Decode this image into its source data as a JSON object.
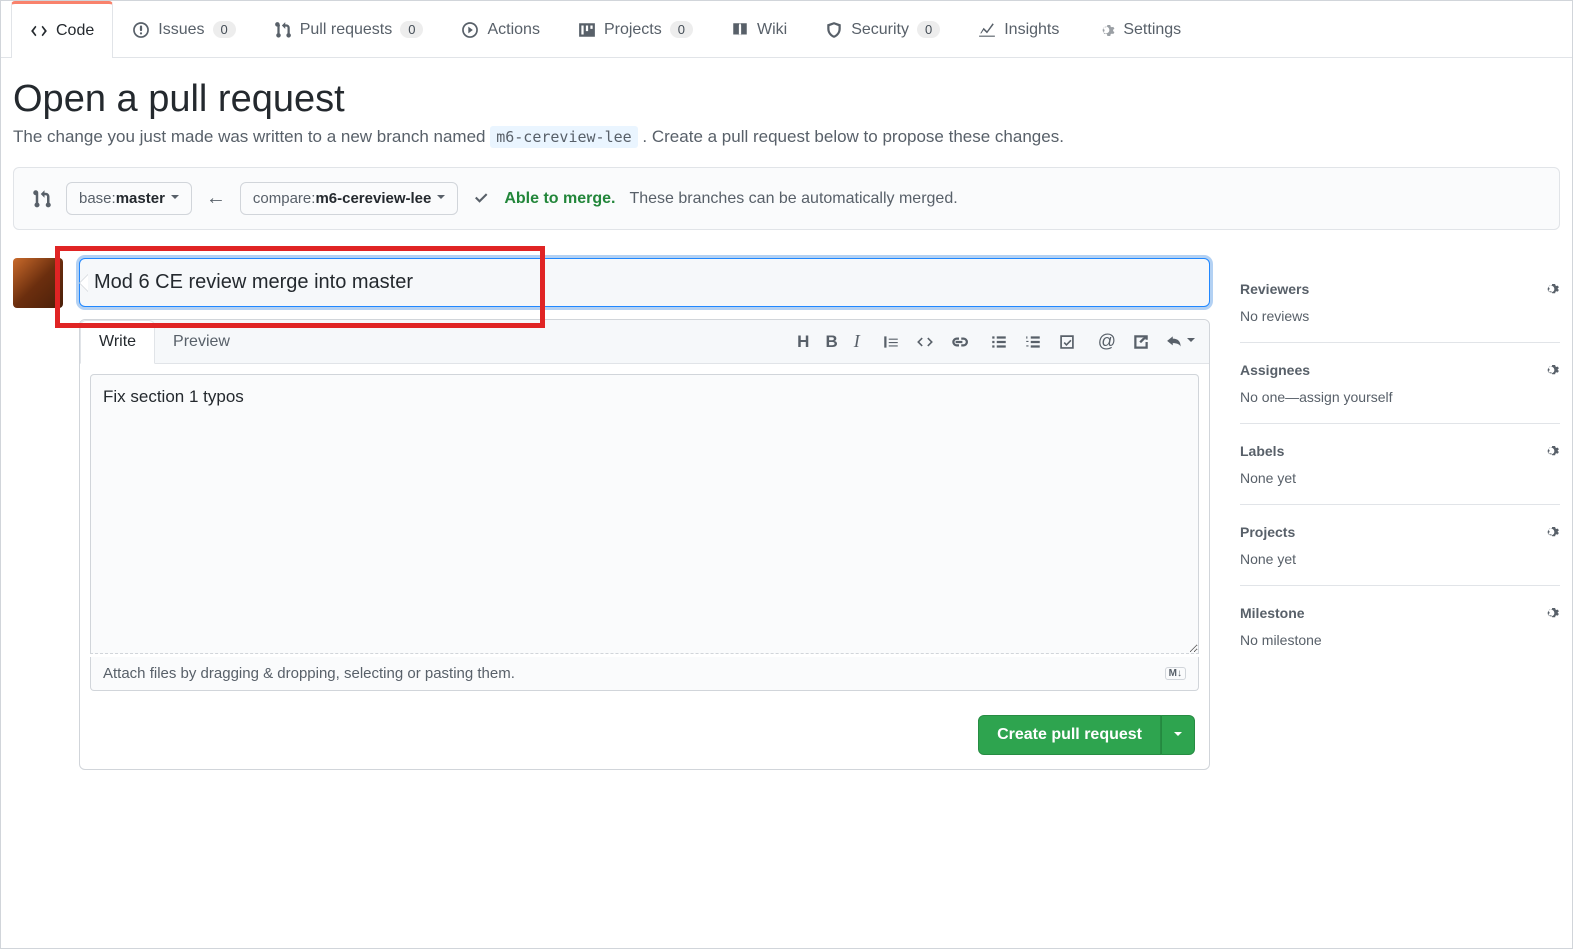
{
  "tabs": {
    "code": "Code",
    "issues": "Issues",
    "issues_count": "0",
    "pulls": "Pull requests",
    "pulls_count": "0",
    "actions": "Actions",
    "projects": "Projects",
    "projects_count": "0",
    "wiki": "Wiki",
    "security": "Security",
    "security_count": "0",
    "insights": "Insights",
    "settings": "Settings"
  },
  "heading": "Open a pull request",
  "subtitle_pre": "The change you just made was written to a new branch named ",
  "subtitle_branch": "m6-cereview-lee",
  "subtitle_post": ". Create a pull request below to propose these changes.",
  "compare": {
    "base_label": "base: ",
    "base_value": "master",
    "compare_label": "compare: ",
    "compare_value": "m6-cereview-lee",
    "merge_ok": "Able to merge.",
    "merge_desc": "These branches can be automatically merged."
  },
  "form": {
    "title": "Mod 6 CE review merge into master",
    "write_tab": "Write",
    "preview_tab": "Preview",
    "body": "Fix section 1 typos",
    "attach": "Attach files by dragging & dropping, selecting or pasting them.",
    "md_badge": "M↓",
    "submit": "Create pull request"
  },
  "sidebar": {
    "reviewers": {
      "title": "Reviewers",
      "value": "No reviews"
    },
    "assignees": {
      "title": "Assignees",
      "value": "No one—assign yourself"
    },
    "labels": {
      "title": "Labels",
      "value": "None yet"
    },
    "projects": {
      "title": "Projects",
      "value": "None yet"
    },
    "milestone": {
      "title": "Milestone",
      "value": "No milestone"
    }
  }
}
